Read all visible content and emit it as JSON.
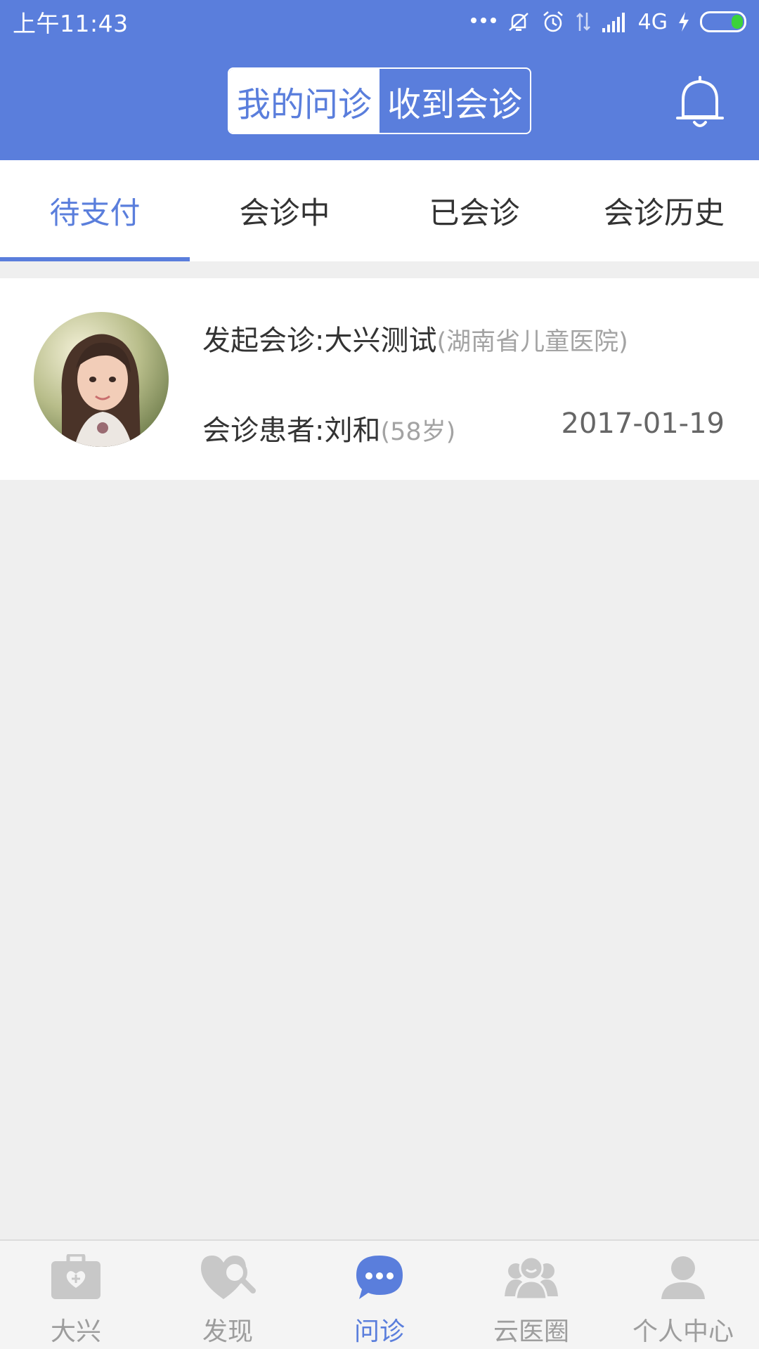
{
  "status_bar": {
    "time": "上午11:43",
    "network": "4G"
  },
  "header": {
    "segments": [
      {
        "label": "我的问诊",
        "active": true
      },
      {
        "label": "收到会诊",
        "active": false
      }
    ],
    "bell_icon": "bell-icon"
  },
  "tabs": [
    {
      "label": "待支付",
      "active": true
    },
    {
      "label": "会诊中",
      "active": false
    },
    {
      "label": "已会诊",
      "active": false
    },
    {
      "label": "会诊历史",
      "active": false
    }
  ],
  "consult_list": [
    {
      "initiator_prefix": "发起会诊:",
      "initiator_name": "大兴测试",
      "hospital": "(湖南省儿童医院)",
      "patient_prefix": "会诊患者:",
      "patient_name": "刘和",
      "patient_age": "(58岁)",
      "date": "2017-01-19"
    }
  ],
  "bottom_nav": [
    {
      "label": "大兴",
      "icon": "medical-kit-icon",
      "active": false
    },
    {
      "label": "发现",
      "icon": "heart-search-icon",
      "active": false
    },
    {
      "label": "问诊",
      "icon": "chat-bubble-icon",
      "active": true
    },
    {
      "label": "云医圈",
      "icon": "group-people-icon",
      "active": false
    },
    {
      "label": "个人中心",
      "icon": "person-icon",
      "active": false
    }
  ],
  "colors": {
    "primary": "#5a7edc",
    "background": "#efefef",
    "nav_inactive": "#c8c8c8",
    "battery": "#3bd33b"
  }
}
